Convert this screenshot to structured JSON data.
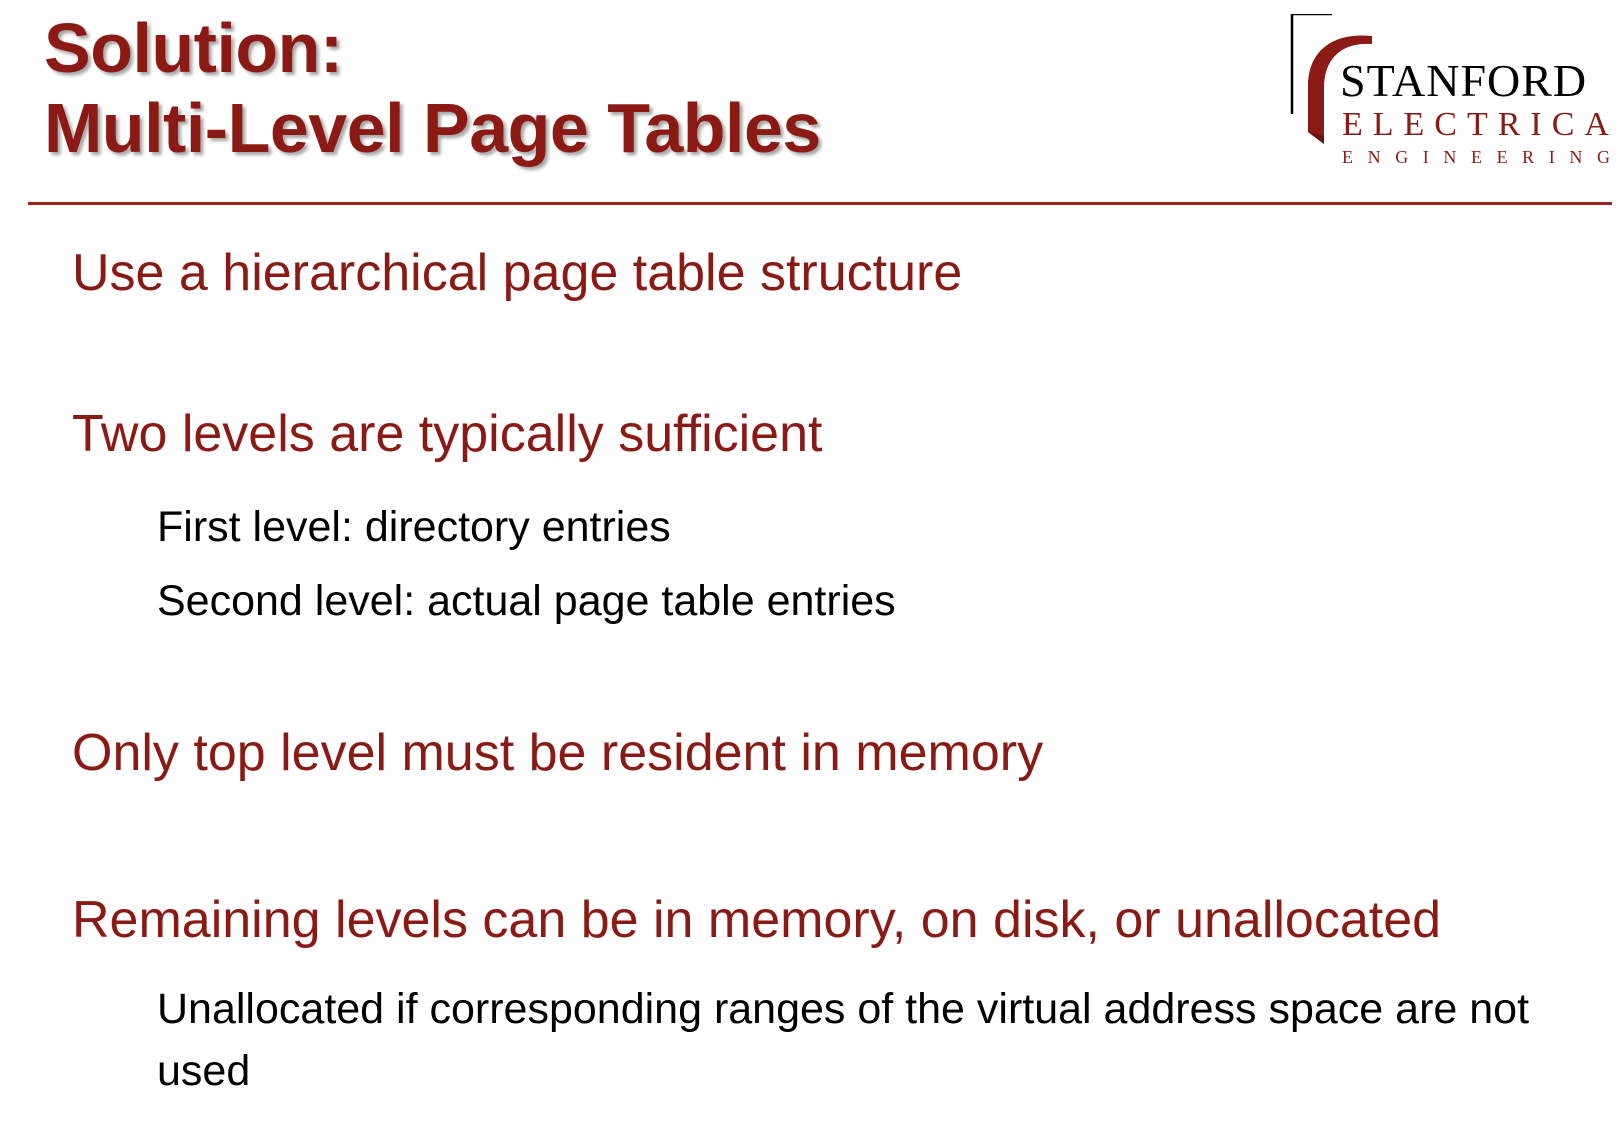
{
  "slide": {
    "title_line1": "Solution:",
    "title_line2": "Multi-Level Page Tables",
    "logo": {
      "line1": "STANFORD",
      "line2": "ELECTRICAL",
      "line3": "ENGINEERING"
    },
    "bullets": [
      {
        "text": "Use a hierarchical page table structure"
      },
      {
        "text": "Two levels are typically sufficient"
      },
      {
        "text": "Only top level must be resident in memory"
      },
      {
        "text": "Remaining levels can be in memory, on disk, or unallocated"
      }
    ],
    "subbullets": [
      {
        "text": "First level: directory entries"
      },
      {
        "text": "Second level: actual page table entries"
      },
      {
        "text": "Unallocated if corresponding ranges of the virtual address space are not used"
      }
    ]
  },
  "colors": {
    "accent": "#8b1a14",
    "divider": "#a3241d",
    "body_text": "#000000"
  }
}
